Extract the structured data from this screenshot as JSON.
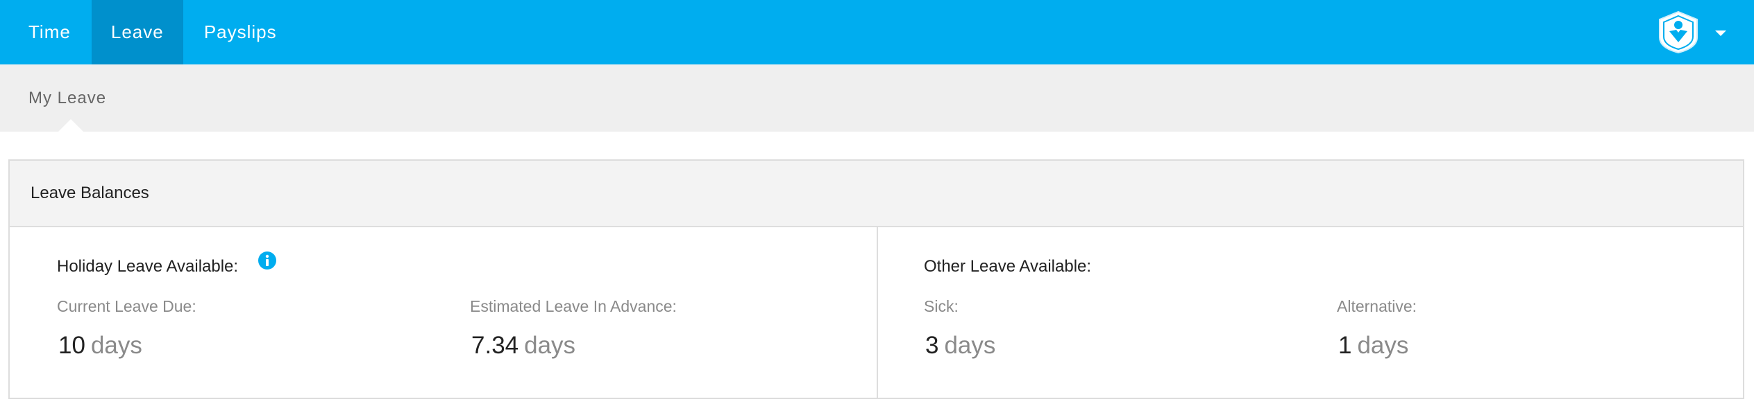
{
  "nav": {
    "items": [
      {
        "label": "Time"
      },
      {
        "label": "Leave"
      },
      {
        "label": "Payslips"
      }
    ],
    "active": "Leave",
    "accent_color": "#00adef",
    "active_color": "#0090cc"
  },
  "user_menu": {
    "icon": "shield-heart-logo-icon"
  },
  "subnav": {
    "title": "My Leave"
  },
  "panel": {
    "title": "Leave Balances",
    "holiday": {
      "title": "Holiday Leave Available:",
      "info_icon": "info-icon",
      "current": {
        "label": "Current Leave Due:",
        "value": "10",
        "unit": "days"
      },
      "advance": {
        "label": "Estimated Leave In Advance:",
        "value": "7.34",
        "unit": "days"
      }
    },
    "other": {
      "title": "Other Leave Available:",
      "sick": {
        "label": "Sick:",
        "value": "3",
        "unit": "days"
      },
      "alternative": {
        "label": "Alternative:",
        "value": "1",
        "unit": "days"
      }
    }
  }
}
